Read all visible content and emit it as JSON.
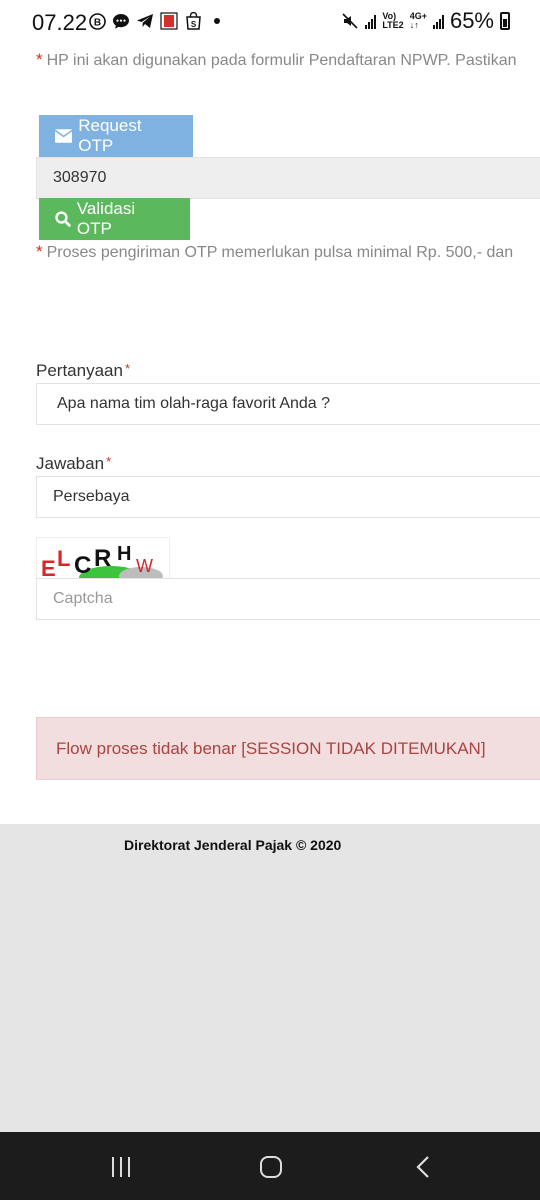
{
  "status_bar": {
    "time": "07.22",
    "battery": "65%",
    "network_label": "4G+",
    "volte_label": "LTE2"
  },
  "form": {
    "phone_note": "HP ini akan digunakan pada formulir Pendaftaran NPWP. Pastikan",
    "request_otp_label": "Request OTP",
    "otp_value": "308970",
    "validate_otp_label": "Validasi OTP",
    "otp_note": "Proses pengiriman OTP memerlukan pulsa minimal Rp. 500,- dan",
    "question_label": "Pertanyaan",
    "question_value": "Apa nama tim olah-raga favorit Anda ?",
    "answer_label": "Jawaban",
    "answer_value": "Persebaya",
    "captcha_placeholder": "Captcha",
    "captcha_image_text": "ELCRHW",
    "required_mark": "*",
    "note_mark": "*"
  },
  "alert": {
    "message": "Flow proses tidak benar [SESSION TIDAK DITEMUKAN]"
  },
  "footer": {
    "copyright": "Direktorat Jenderal Pajak © 2020"
  },
  "colors": {
    "request_btn": "#7fb2e0",
    "validate_btn": "#5cb85c",
    "alert_bg": "#f2dede",
    "alert_text": "#a94442",
    "required": "#c9302c"
  }
}
